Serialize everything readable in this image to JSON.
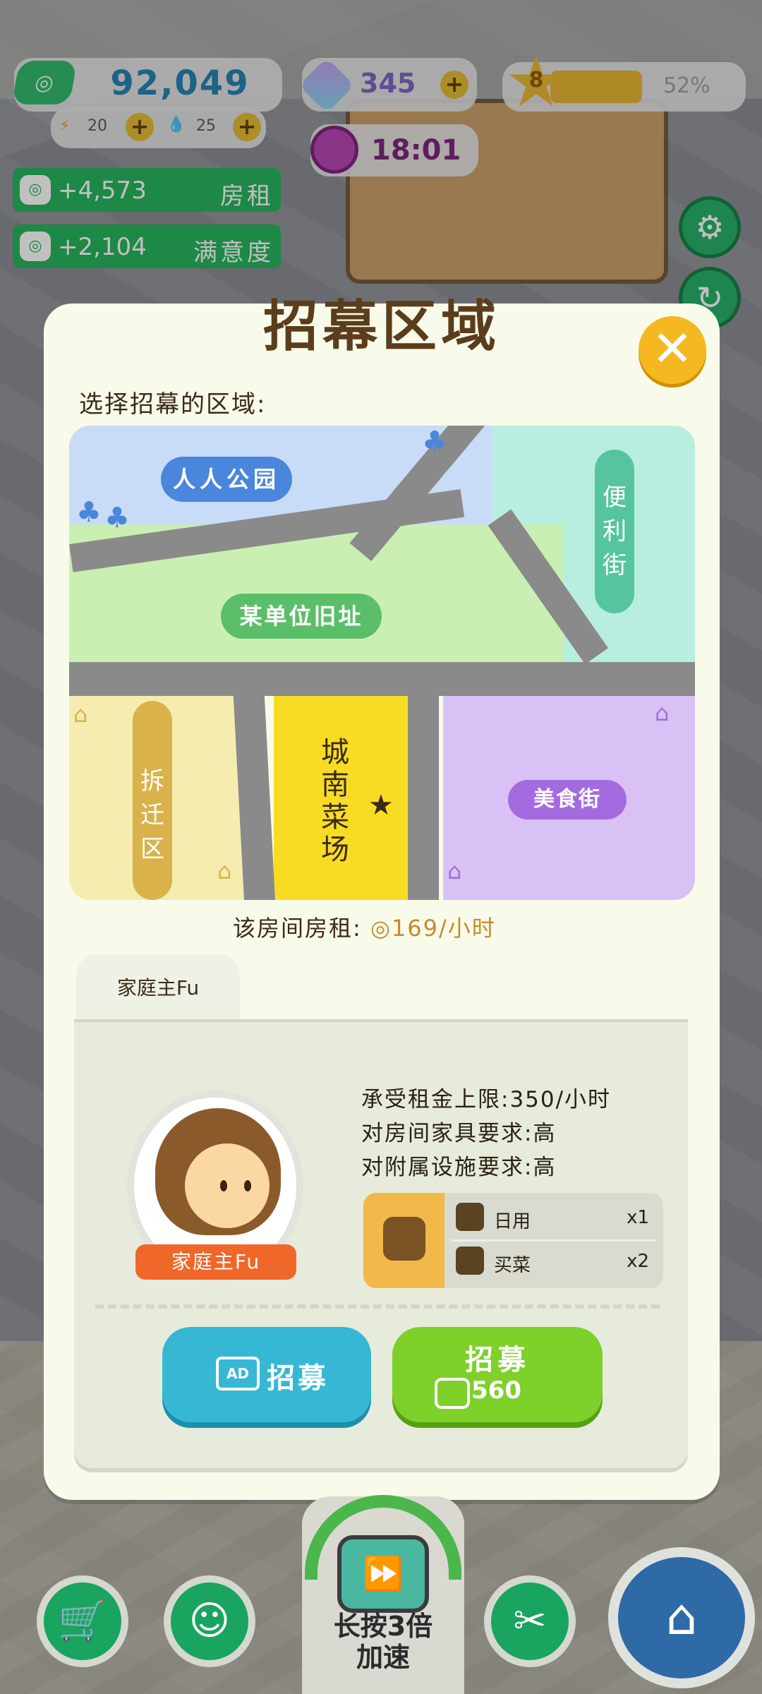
{
  "hud": {
    "money": "92,049",
    "energy": "20",
    "water": "25",
    "gems": "345",
    "level": "8",
    "level_progress_label": "52%",
    "level_progress": 0.52,
    "time": "18:01",
    "rent_income": "+4,573",
    "rent_label": "房租",
    "satisfaction_income": "+2,104",
    "satisfaction_label": "满意度"
  },
  "dialog": {
    "title": "招幕区域",
    "subtitle": "选择招幕的区域:",
    "map": {
      "park": "人人公园",
      "old_site": "某单位旧址",
      "convenience_street": "便利街",
      "demolition_zone": "拆迁区",
      "city_south_market": "城南菜场",
      "food_street": "美食街"
    },
    "rent_prefix": "该房间房租:",
    "rent_value": "169/小时",
    "tab_label": "家庭主Fu",
    "tenant": {
      "name": "家庭主Fu",
      "rent_limit": "承受租金上限:350/小时",
      "furniture_req": "对房间家具要求:高",
      "facility_req": "对附属设施要求:高",
      "needs": [
        {
          "name": "日用",
          "count": "x1",
          "icon": "cup-icon"
        },
        {
          "name": "买菜",
          "count": "x2",
          "icon": "basket-icon"
        }
      ]
    },
    "ad_button": {
      "icon": "AD",
      "label": "招募"
    },
    "buy_button": {
      "label": "招募",
      "price": "560"
    }
  },
  "bottom": {
    "speed_label_line1": "长按3倍",
    "speed_label_line2": "加速"
  }
}
